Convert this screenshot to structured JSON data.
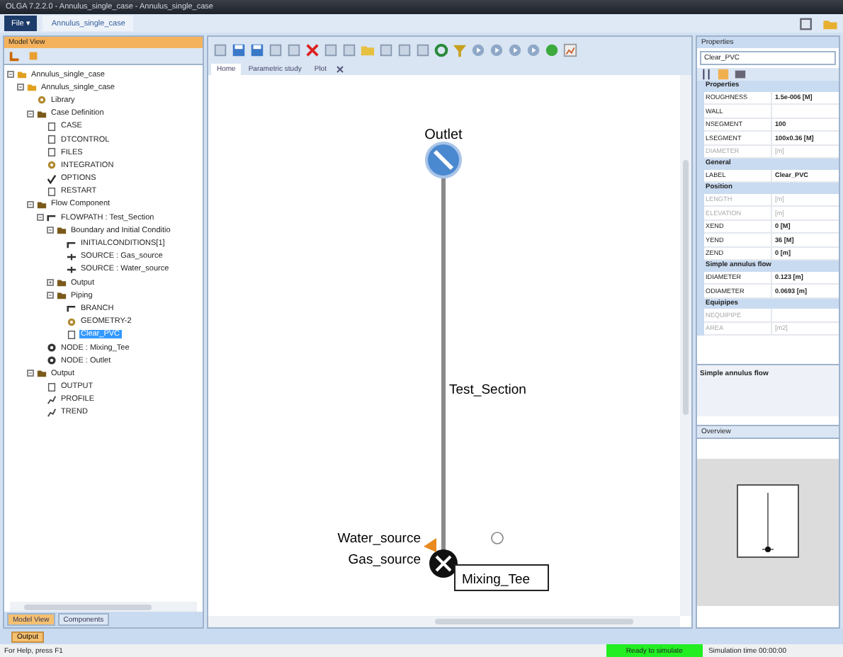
{
  "window": {
    "title": "OLGA 7.2.2.0 - Annulus_single_case - Annulus_single_case"
  },
  "menu": {
    "file_button": "File ▾",
    "document_tab": "Annulus_single_case"
  },
  "model_view": {
    "title": "Model View",
    "tree": [
      {
        "label": "Annulus_single_case",
        "kind": "project",
        "expanded": true,
        "selected": false,
        "children": [
          {
            "label": "Annulus_single_case",
            "kind": "project",
            "expanded": true,
            "selected": false,
            "children": [
              {
                "label": "Library",
                "kind": "gear",
                "selected": false
              },
              {
                "label": "Case Definition",
                "kind": "folder",
                "expanded": true,
                "selected": false,
                "children": [
                  {
                    "label": "CASE",
                    "kind": "doc",
                    "selected": false
                  },
                  {
                    "label": "DTCONTROL",
                    "kind": "doc",
                    "selected": false
                  },
                  {
                    "label": "FILES",
                    "kind": "doc",
                    "selected": false
                  },
                  {
                    "label": "INTEGRATION",
                    "kind": "gear",
                    "selected": false
                  },
                  {
                    "label": "OPTIONS",
                    "kind": "check",
                    "selected": false
                  },
                  {
                    "label": "RESTART",
                    "kind": "doc",
                    "selected": false
                  }
                ]
              },
              {
                "label": "Flow Component",
                "kind": "folder",
                "expanded": true,
                "selected": false,
                "children": [
                  {
                    "label": "FLOWPATH : Test_Section",
                    "kind": "pipe",
                    "expanded": true,
                    "selected": false,
                    "children": [
                      {
                        "label": "Boundary and Initial Conditio",
                        "kind": "folder",
                        "expanded": true,
                        "selected": false,
                        "children": [
                          {
                            "label": "INITIALCONDITIONS[1]",
                            "kind": "pipe",
                            "selected": false
                          },
                          {
                            "label": "SOURCE : Gas_source",
                            "kind": "source",
                            "selected": false
                          },
                          {
                            "label": "SOURCE : Water_source",
                            "kind": "source",
                            "selected": false
                          }
                        ]
                      },
                      {
                        "label": "Output",
                        "kind": "folder",
                        "expanded": false,
                        "selected": false
                      },
                      {
                        "label": "Piping",
                        "kind": "folder",
                        "expanded": true,
                        "selected": false,
                        "children": [
                          {
                            "label": "BRANCH",
                            "kind": "pipe",
                            "selected": false
                          },
                          {
                            "label": "GEOMETRY-2",
                            "kind": "gear",
                            "selected": false
                          },
                          {
                            "label": "Clear_PVC",
                            "kind": "doc",
                            "selected": true
                          }
                        ]
                      }
                    ]
                  },
                  {
                    "label": "NODE : Mixing_Tee",
                    "kind": "node",
                    "selected": false
                  },
                  {
                    "label": "NODE : Outlet",
                    "kind": "node",
                    "selected": false
                  }
                ]
              },
              {
                "label": "Output",
                "kind": "folder",
                "expanded": true,
                "selected": false,
                "children": [
                  {
                    "label": "OUTPUT",
                    "kind": "doc",
                    "selected": false
                  },
                  {
                    "label": "PROFILE",
                    "kind": "chart",
                    "selected": false
                  },
                  {
                    "label": "TREND",
                    "kind": "chart",
                    "selected": false
                  }
                ]
              }
            ]
          }
        ]
      }
    ],
    "bottom_tabs": [
      {
        "label": "Model View",
        "selected": true
      },
      {
        "label": "Components",
        "selected": false
      }
    ]
  },
  "editor": {
    "tabs": [
      {
        "label": "Home",
        "selected": true
      },
      {
        "label": "Parametric study",
        "selected": false
      },
      {
        "label": "Plot",
        "selected": false
      }
    ],
    "diagram": {
      "nodes": [
        {
          "label": "Outlet",
          "kind": "outlet"
        },
        {
          "label": "Mixing_Tee",
          "kind": "mixer"
        }
      ],
      "pipe_label": "Test_Section",
      "sources": [
        {
          "label": "Water_source"
        },
        {
          "label": "Gas_source"
        }
      ]
    }
  },
  "properties": {
    "title": "Properties",
    "object": "Clear_PVC",
    "groups": [
      {
        "name": "Properties",
        "rows": [
          {
            "name": "ROUGHNESS",
            "value": "1.5e-006 [M]",
            "disabled": false
          },
          {
            "name": "WALL",
            "disabled": false
          },
          {
            "name": "NSEGMENT",
            "value": "100",
            "disabled": false
          },
          {
            "name": "LSEGMENT",
            "value": "100x0.36 [M]",
            "disabled": false
          },
          {
            "name": "DIAMETER",
            "value": "[m]",
            "disabled": true
          }
        ]
      },
      {
        "name": "General",
        "rows": [
          {
            "name": "LABEL",
            "value": "Clear_PVC",
            "disabled": false
          }
        ]
      },
      {
        "name": "Position",
        "rows": [
          {
            "name": "LENGTH",
            "value": "[m]",
            "disabled": true
          },
          {
            "name": "ELEVATION",
            "value": "[m]",
            "disabled": true
          },
          {
            "name": "XEND",
            "value": "0 [M]",
            "disabled": false
          },
          {
            "name": "YEND",
            "value": "36 [M]",
            "disabled": false
          },
          {
            "name": "ZEND",
            "value": "0 [m]",
            "disabled": false
          }
        ]
      },
      {
        "name": "Simple annulus flow",
        "rows": [
          {
            "name": "IDIAMETER",
            "value": "0.123 [m]",
            "disabled": false
          },
          {
            "name": "ODIAMETER",
            "value": "0.0693 [m]",
            "disabled": false
          }
        ]
      },
      {
        "name": "Equipipes",
        "rows": [
          {
            "name": "NEQUIPIPE",
            "disabled": true
          },
          {
            "name": "AREA",
            "value": "[m2]",
            "disabled": true
          }
        ]
      }
    ],
    "description": "Simple annulus flow"
  },
  "overview": {
    "title": "Overview"
  },
  "output_tab": "Output",
  "status_bar": {
    "help": "For Help, press F1",
    "state": "Ready to simulate",
    "time": "Simulation time 00:00:00"
  }
}
